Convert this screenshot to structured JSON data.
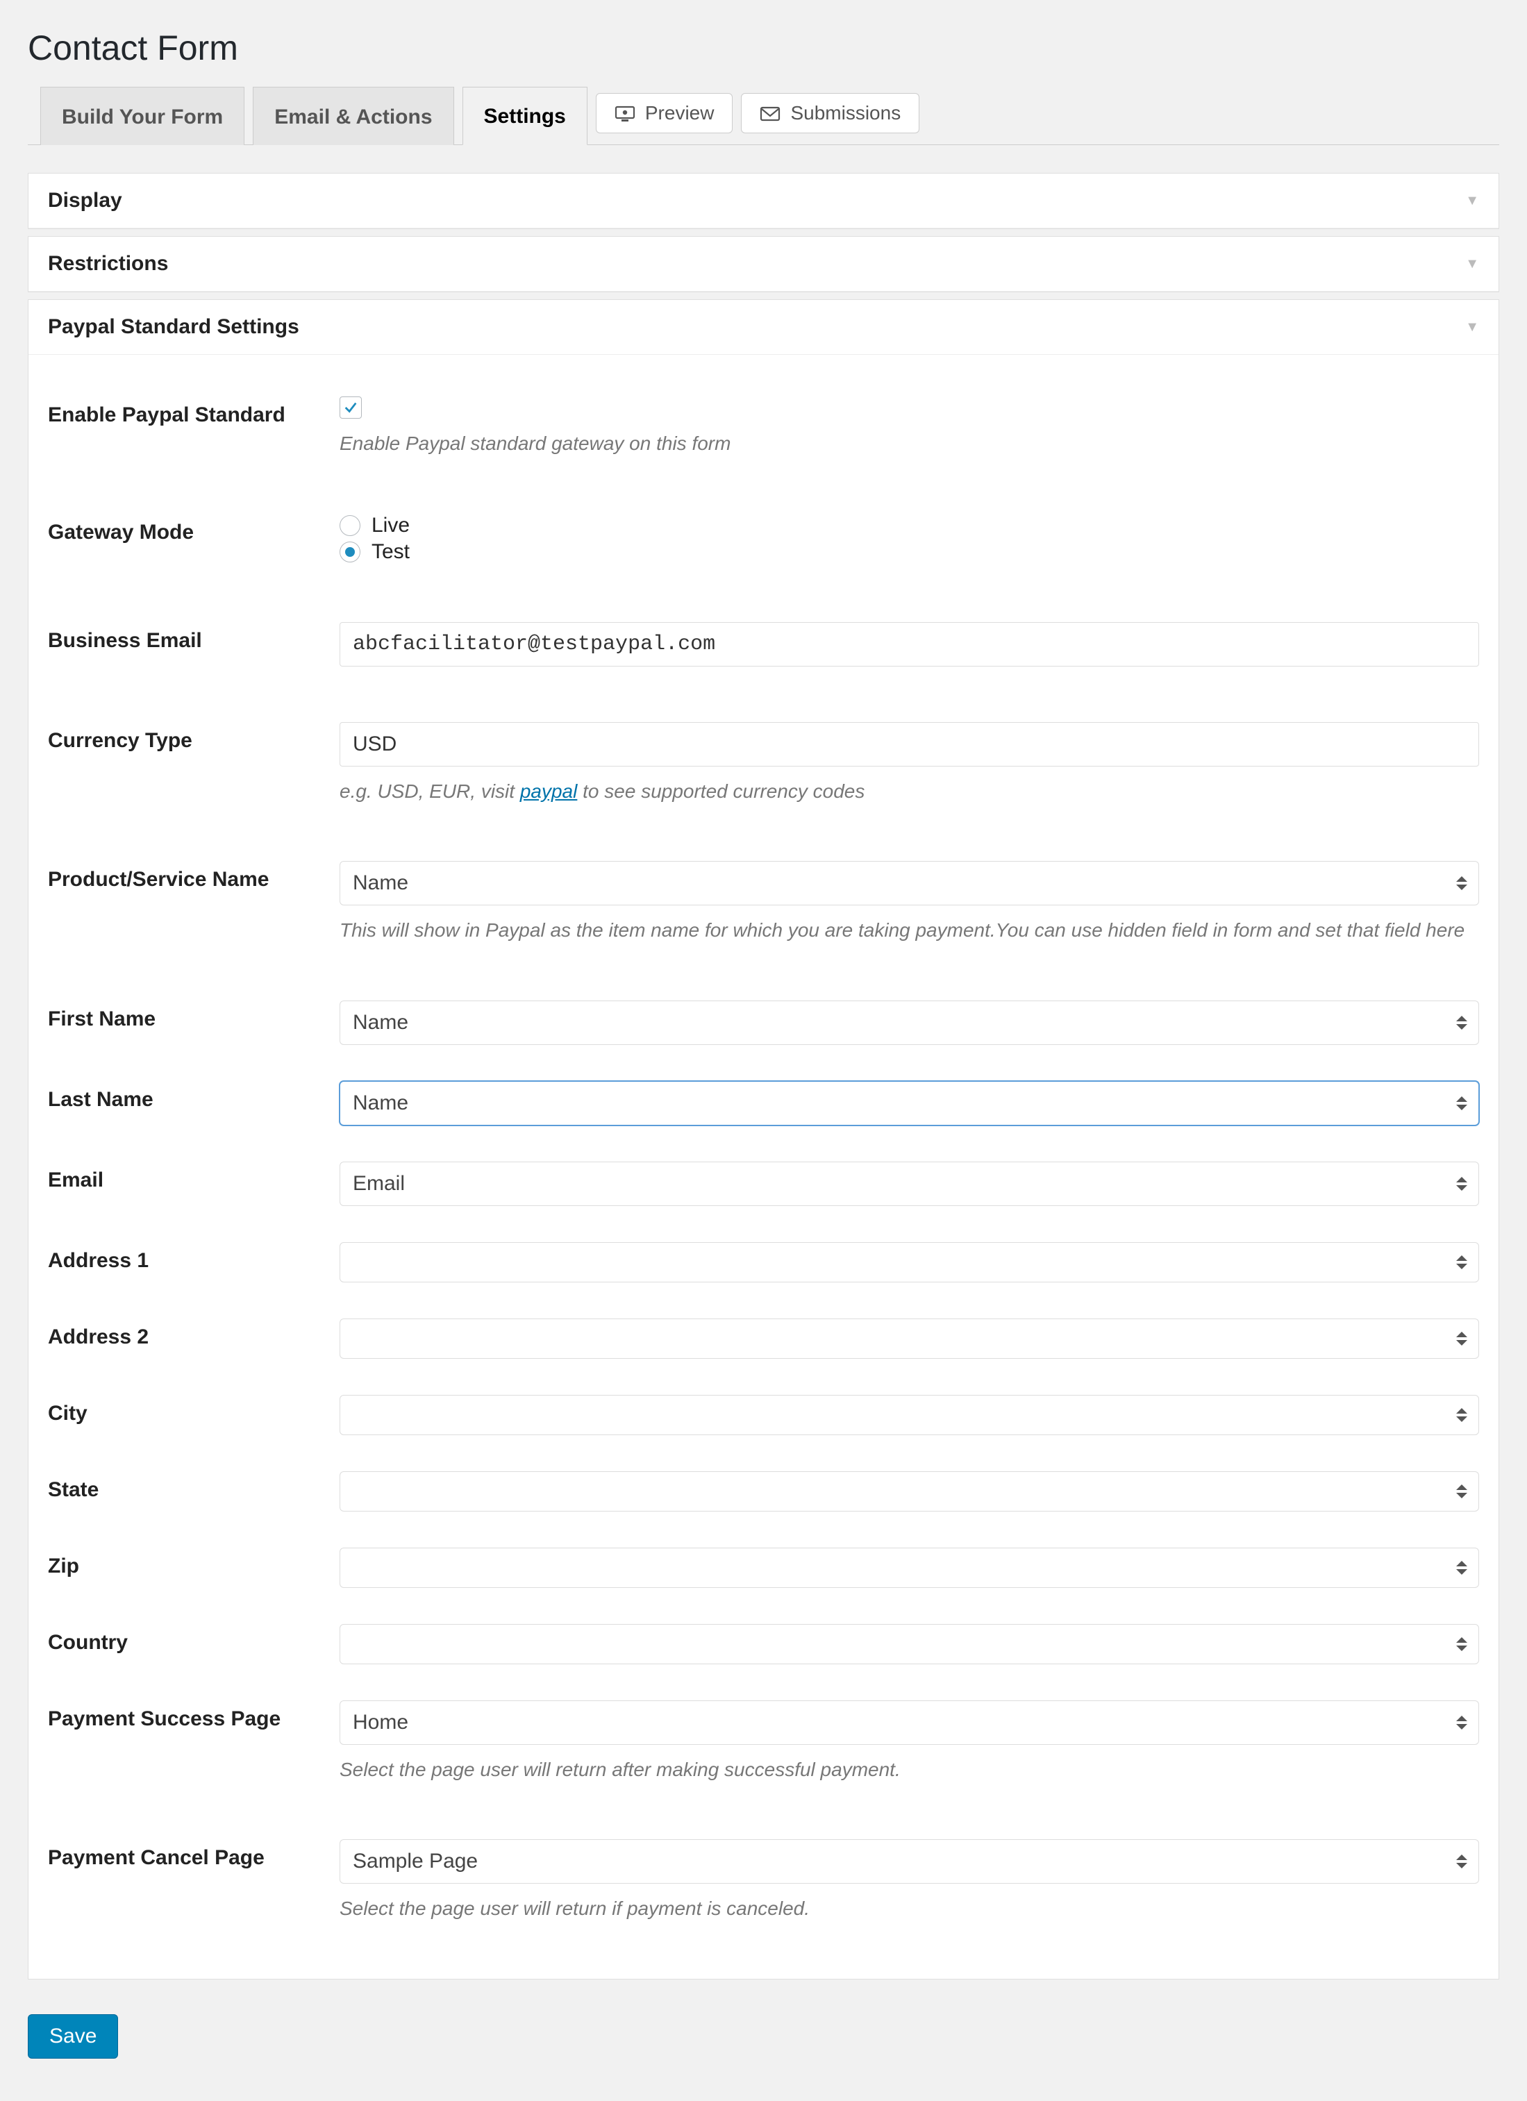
{
  "page": {
    "title": "Contact Form"
  },
  "tabs": {
    "build": "Build Your Form",
    "email": "Email & Actions",
    "settings": "Settings",
    "preview": "Preview",
    "submissions": "Submissions",
    "active": "settings"
  },
  "panels": {
    "display": {
      "title": "Display"
    },
    "restrictions": {
      "title": "Restrictions"
    },
    "paypal": {
      "title": "Paypal Standard Settings"
    }
  },
  "paypal": {
    "enable": {
      "label": "Enable Paypal Standard",
      "checked": true,
      "hint": "Enable Paypal standard gateway on this form"
    },
    "mode": {
      "label": "Gateway Mode",
      "live": "Live",
      "test": "Test",
      "value": "test"
    },
    "business_email": {
      "label": "Business Email",
      "value": "abcfacilitator@testpaypal.com"
    },
    "currency": {
      "label": "Currency Type",
      "value": "USD",
      "hint_pre": "e.g. USD, EUR, visit ",
      "hint_link": "paypal",
      "hint_post": " to see supported currency codes"
    },
    "product": {
      "label": "Product/Service Name",
      "value": "Name",
      "hint": "This will show in Paypal as the item name for which you are taking payment.You can use hidden field in form and set that field here"
    },
    "first_name": {
      "label": "First Name",
      "value": "Name"
    },
    "last_name": {
      "label": "Last Name",
      "value": "Name",
      "focused": true
    },
    "email": {
      "label": "Email",
      "value": "Email"
    },
    "address1": {
      "label": "Address 1",
      "value": ""
    },
    "address2": {
      "label": "Address 2",
      "value": ""
    },
    "city": {
      "label": "City",
      "value": ""
    },
    "state": {
      "label": "State",
      "value": ""
    },
    "zip": {
      "label": "Zip",
      "value": ""
    },
    "country": {
      "label": "Country",
      "value": ""
    },
    "success_page": {
      "label": "Payment Success Page",
      "value": "Home",
      "hint": "Select the page user will return after making successful payment."
    },
    "cancel_page": {
      "label": "Payment Cancel Page",
      "value": "Sample Page",
      "hint": "Select the page user will return if payment is canceled."
    }
  },
  "actions": {
    "save": "Save"
  }
}
